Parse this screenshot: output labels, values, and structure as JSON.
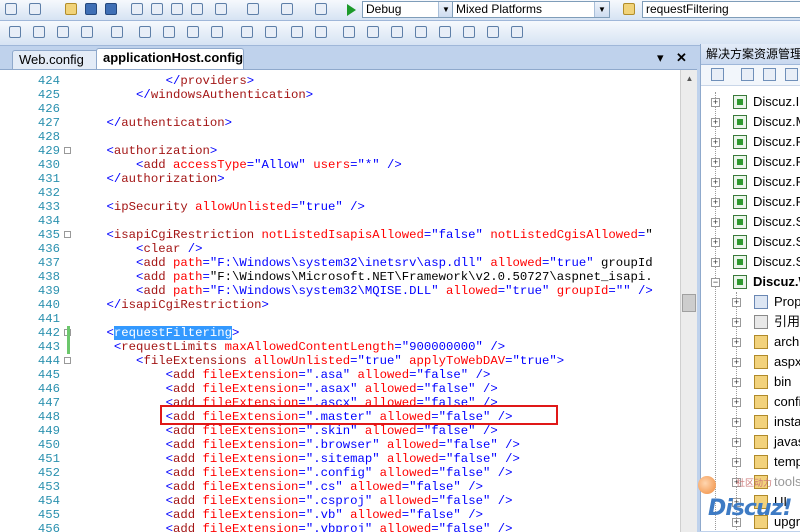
{
  "toolbar": {
    "config_dropdown": "Debug",
    "platform_dropdown": "Mixed Platforms",
    "find_box": "requestFiltering"
  },
  "tabs": [
    {
      "label": "Web.config"
    },
    {
      "label": "applicationHost.config"
    }
  ],
  "tab_controls": {
    "dropdown": "▾",
    "close": "✕"
  },
  "editor": {
    "lines": [
      {
        "n": "424",
        "code": "            </providers>"
      },
      {
        "n": "425",
        "code": "        </windowsAuthentication>"
      },
      {
        "n": "426",
        "code": ""
      },
      {
        "n": "427",
        "code": "    </authentication>"
      },
      {
        "n": "428",
        "code": ""
      },
      {
        "n": "429",
        "code": "    <authorization>"
      },
      {
        "n": "430",
        "code": "        <add accessType=\"Allow\" users=\"*\" />"
      },
      {
        "n": "431",
        "code": "    </authorization>"
      },
      {
        "n": "432",
        "code": ""
      },
      {
        "n": "433",
        "code": "    <ipSecurity allowUnlisted=\"true\" />"
      },
      {
        "n": "434",
        "code": ""
      },
      {
        "n": "435",
        "code": "    <isapiCgiRestriction notListedIsapisAllowed=\"false\" notListedCgisAllowed=\""
      },
      {
        "n": "436",
        "code": "        <clear />"
      },
      {
        "n": "437",
        "code": "        <add path=\"F:\\Windows\\system32\\inetsrv\\asp.dll\" allowed=\"true\" groupId"
      },
      {
        "n": "438",
        "code": "        <add path=\"F:\\Windows\\Microsoft.NET\\Framework\\v2.0.50727\\aspnet_isapi."
      },
      {
        "n": "439",
        "code": "        <add path=\"F:\\Windows\\system32\\MQISE.DLL\" allowed=\"true\" groupId=\"\" />"
      },
      {
        "n": "440",
        "code": "    </isapiCgiRestriction>"
      },
      {
        "n": "441",
        "code": ""
      },
      {
        "n": "442",
        "code": "    <requestFiltering>"
      },
      {
        "n": "443",
        "code": "     <requestLimits maxAllowedContentLength=\"900000000\" />"
      },
      {
        "n": "444",
        "code": "        <fileExtensions allowUnlisted=\"true\" applyToWebDAV=\"true\">"
      },
      {
        "n": "445",
        "code": "            <add fileExtension=\".asa\" allowed=\"false\" />"
      },
      {
        "n": "446",
        "code": "            <add fileExtension=\".asax\" allowed=\"false\" />"
      },
      {
        "n": "447",
        "code": "            <add fileExtension=\".ascx\" allowed=\"false\" />"
      },
      {
        "n": "448",
        "code": "            <add fileExtension=\".master\" allowed=\"false\" />"
      },
      {
        "n": "449",
        "code": "            <add fileExtension=\".skin\" allowed=\"false\" />"
      },
      {
        "n": "450",
        "code": "            <add fileExtension=\".browser\" allowed=\"false\" />"
      },
      {
        "n": "451",
        "code": "            <add fileExtension=\".sitemap\" allowed=\"false\" />"
      },
      {
        "n": "452",
        "code": "            <add fileExtension=\".config\" allowed=\"false\" />"
      },
      {
        "n": "453",
        "code": "            <add fileExtension=\".cs\" allowed=\"false\" />"
      },
      {
        "n": "454",
        "code": "            <add fileExtension=\".csproj\" allowed=\"false\" />"
      },
      {
        "n": "455",
        "code": "            <add fileExtension=\".vb\" allowed=\"false\" />"
      },
      {
        "n": "456",
        "code": "            <add fileExtension=\".vbproj\" allowed=\"false\" />"
      }
    ]
  },
  "solution_explorer": {
    "title": "解决方案资源管理",
    "items": [
      {
        "label": "Discuz.In",
        "icon": "project-icon",
        "expand": "+"
      },
      {
        "label": "Discuz.M",
        "icon": "project-icon",
        "expand": "+"
      },
      {
        "label": "Discuz.P",
        "icon": "project-icon",
        "expand": "+"
      },
      {
        "label": "Discuz.P",
        "icon": "project-icon",
        "expand": "+"
      },
      {
        "label": "Discuz.P",
        "icon": "project-icon",
        "expand": "+"
      },
      {
        "label": "Discuz.P",
        "icon": "project-icon",
        "expand": "+"
      },
      {
        "label": "Discuz.S",
        "icon": "project-icon",
        "expand": "+"
      },
      {
        "label": "Discuz.S",
        "icon": "project-icon",
        "expand": "+"
      },
      {
        "label": "Discuz.S",
        "icon": "project-icon",
        "expand": "+"
      },
      {
        "label": "Discuz.W",
        "icon": "project-icon",
        "expand": "−"
      },
      {
        "label": "Prop",
        "icon": "properties-icon",
        "expand": "+"
      },
      {
        "label": "引用",
        "icon": "references-icon",
        "expand": "+"
      },
      {
        "label": "archi",
        "icon": "folder-icon",
        "expand": "+"
      },
      {
        "label": "aspx",
        "icon": "folder-icon",
        "expand": "+"
      },
      {
        "label": "bin",
        "icon": "folder-icon",
        "expand": "+"
      },
      {
        "label": "confi",
        "icon": "folder-icon",
        "expand": "+"
      },
      {
        "label": "insta",
        "icon": "folder-icon",
        "expand": "+"
      },
      {
        "label": "javas",
        "icon": "folder-icon",
        "expand": "+"
      },
      {
        "label": "temp",
        "icon": "folder-icon",
        "expand": "+"
      },
      {
        "label": "tools",
        "icon": "folder-icon",
        "expand": "+"
      },
      {
        "label": "UI",
        "icon": "folder-icon",
        "expand": "+"
      },
      {
        "label": "upgr",
        "icon": "folder-icon",
        "expand": "+"
      }
    ]
  },
  "watermark": {
    "brand": "Discuz!",
    "small": "社区动力"
  }
}
